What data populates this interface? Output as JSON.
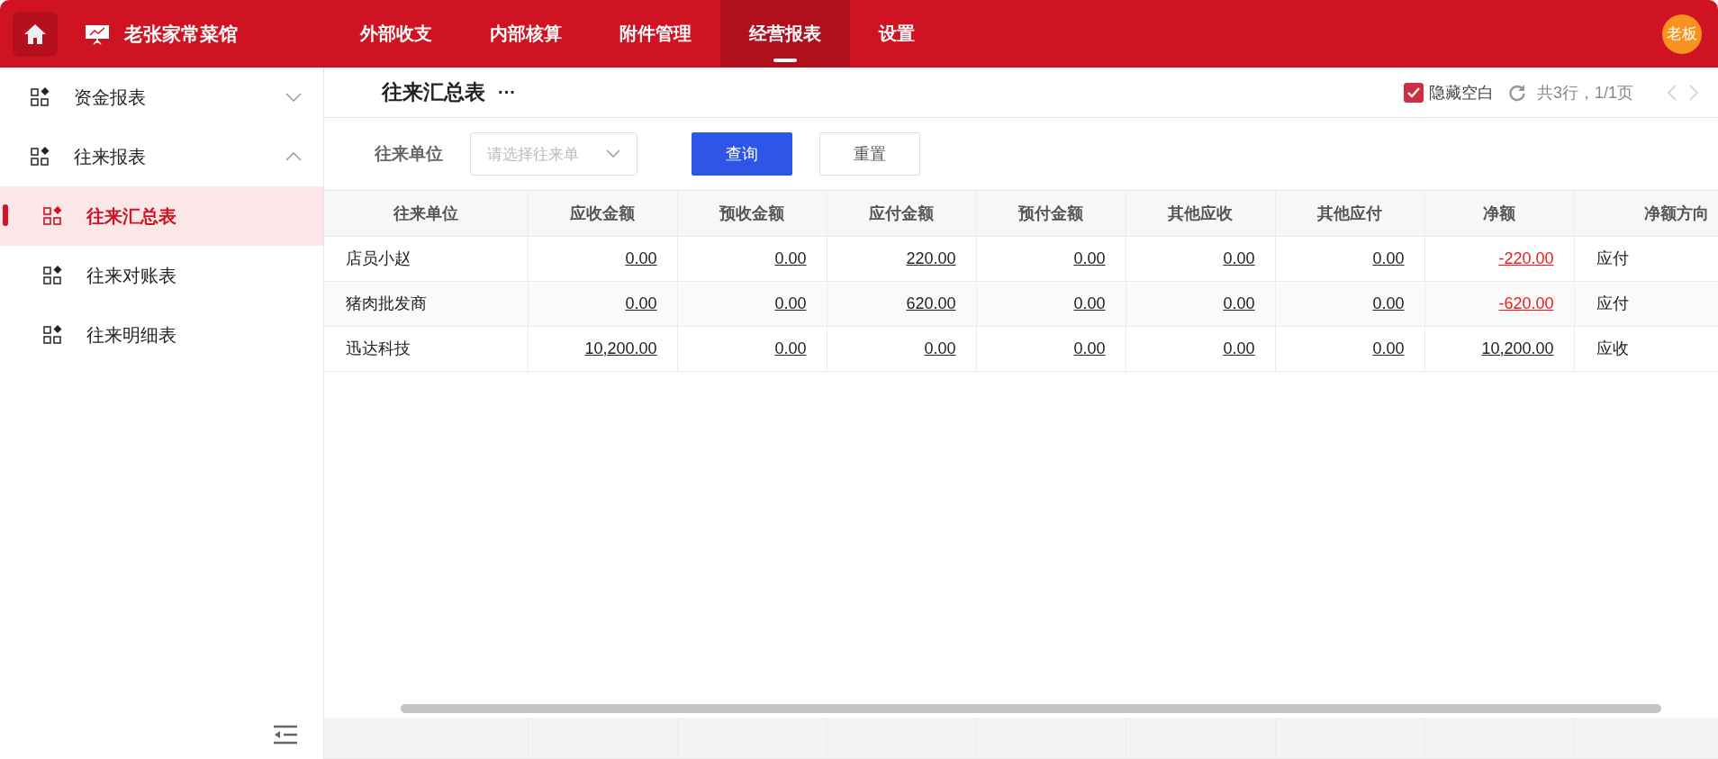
{
  "app": {
    "name": "老张家常菜馆",
    "user": "老板"
  },
  "nav": [
    {
      "label": "外部收支",
      "selected": false
    },
    {
      "label": "内部核算",
      "selected": false
    },
    {
      "label": "附件管理",
      "selected": false
    },
    {
      "label": "经营报表",
      "selected": true
    },
    {
      "label": "设置",
      "selected": false
    }
  ],
  "sidebar": {
    "items": [
      {
        "label": "资金报表",
        "expanded": false
      },
      {
        "label": "往来报表",
        "expanded": true,
        "children": [
          {
            "label": "往来汇总表",
            "selected": true
          },
          {
            "label": "往来对账表",
            "selected": false
          },
          {
            "label": "往来明细表",
            "selected": false
          }
        ]
      }
    ]
  },
  "page": {
    "title": "往来汇总表",
    "more": "···",
    "hide_blank": {
      "label": "隐藏空白",
      "checked": true
    },
    "summary": "共3行，1/1页"
  },
  "filter": {
    "label": "往来单位",
    "placeholder": "请选择往来单",
    "query": "查询",
    "reset": "重置"
  },
  "table": {
    "columns": [
      "往来单位",
      "应收金额",
      "预收金额",
      "应付金额",
      "预付金额",
      "其他应收",
      "其他应付",
      "净额",
      "净额方向"
    ],
    "rows": [
      {
        "unit": "店员小赵",
        "amounts": [
          "0.00",
          "0.00",
          "220.00",
          "0.00",
          "0.00",
          "0.00"
        ],
        "net": {
          "value": "-220.00",
          "negative": true
        },
        "direction": "应付"
      },
      {
        "unit": "猪肉批发商",
        "amounts": [
          "0.00",
          "0.00",
          "620.00",
          "0.00",
          "0.00",
          "0.00"
        ],
        "net": {
          "value": "-620.00",
          "negative": true
        },
        "direction": "应付"
      },
      {
        "unit": "迅达科技",
        "amounts": [
          "10,200.00",
          "0.00",
          "0.00",
          "0.00",
          "0.00",
          "0.00"
        ],
        "net": {
          "value": "10,200.00",
          "negative": false
        },
        "direction": "应收"
      }
    ]
  }
}
